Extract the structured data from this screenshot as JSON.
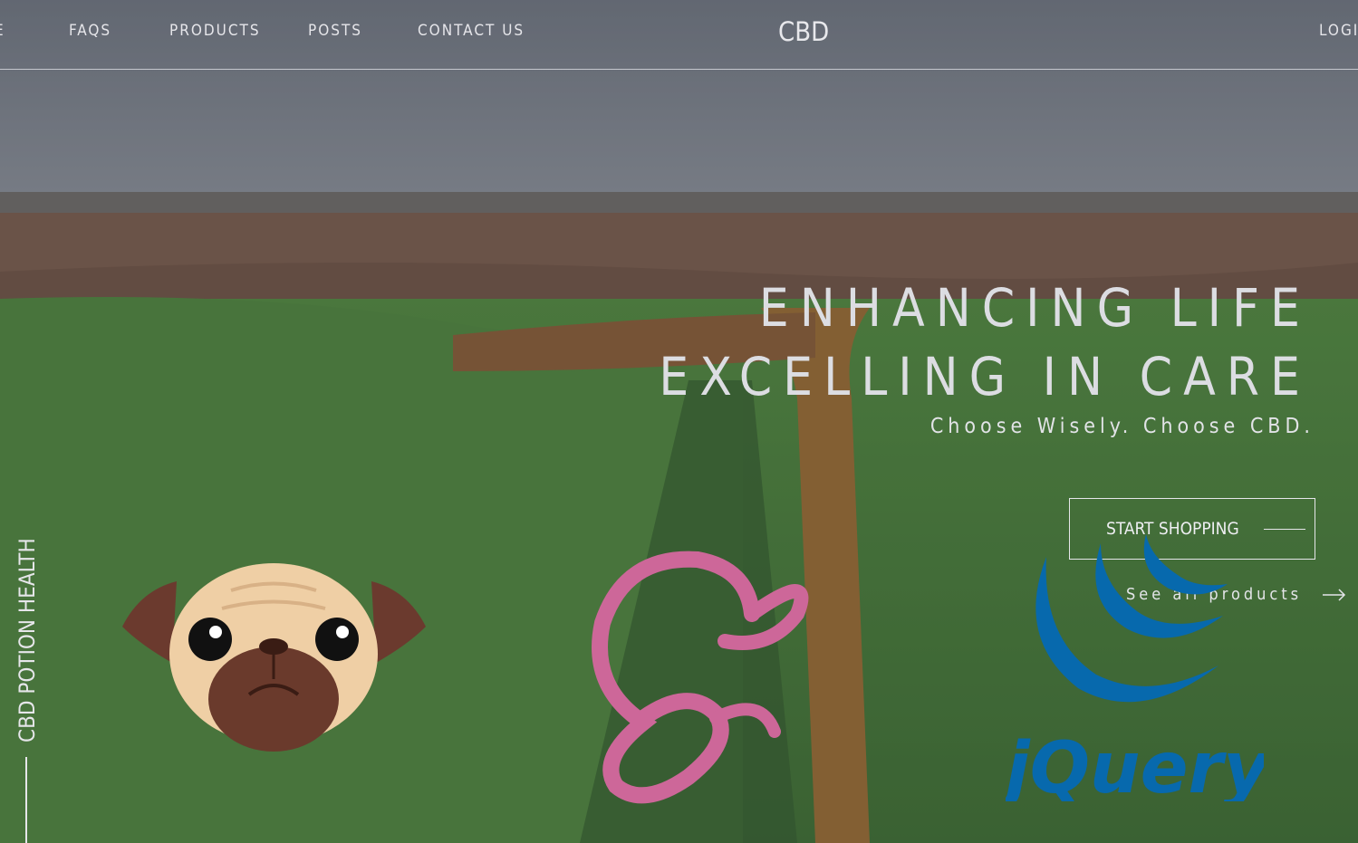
{
  "nav": {
    "partial_left": "E",
    "links": [
      "FAQS",
      "PRODUCTS",
      "POSTS",
      "CONTACT US"
    ],
    "brand": "CBD",
    "login": "LOGIN"
  },
  "hero": {
    "line1": "ENHANCING LIFE",
    "line2": "EXCELLING IN CARE",
    "subtitle": "Choose Wisely. Choose CBD.",
    "cta_label": "START SHOPPING",
    "see_all": "See all products"
  },
  "side": {
    "vertical_text": "CBD POTION HEALTH"
  },
  "overlays": {
    "pug_icon": "pug-logo",
    "sass_icon": "sass-logo",
    "jquery_text": "jQuery",
    "colors": {
      "sass_pink": "#cd6799",
      "jquery_blue": "#0769ad"
    }
  }
}
